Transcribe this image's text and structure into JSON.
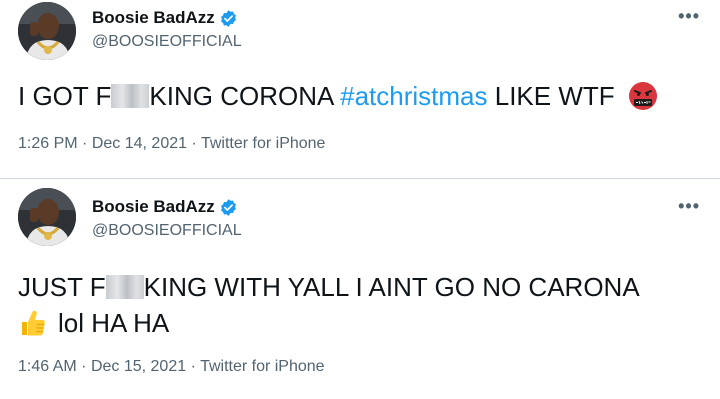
{
  "tweets": [
    {
      "display_name": "Boosie BadAzz",
      "handle": "@BOOSIEOFFICIAL",
      "more_label": "•••",
      "text_before_blur": "I GOT F",
      "text_after_blur": "KING CORONA ",
      "hashtag": "#atchristmas",
      "text_end": " LIKE WTF",
      "emoji_icon": "angry-face-symbols-icon",
      "time": "1:26 PM",
      "date": "Dec 14, 2021",
      "source": "Twitter for iPhone"
    },
    {
      "display_name": "Boosie BadAzz",
      "handle": "@BOOSIEOFFICIAL",
      "more_label": "•••",
      "text_before_blur": "JUST F",
      "text_after_blur": "KING  WITH YALL I AINT GO NO CARONA",
      "line2_text": "lol HA HA",
      "emoji_icon": "thumbs-up-icon",
      "time": "1:46 AM",
      "date": "Dec 15, 2021",
      "source": "Twitter for iPhone"
    }
  ],
  "meta_separator": "·",
  "colors": {
    "accent": "#1d9bf0",
    "secondary_text": "#536471",
    "divider": "#cfd9de"
  }
}
